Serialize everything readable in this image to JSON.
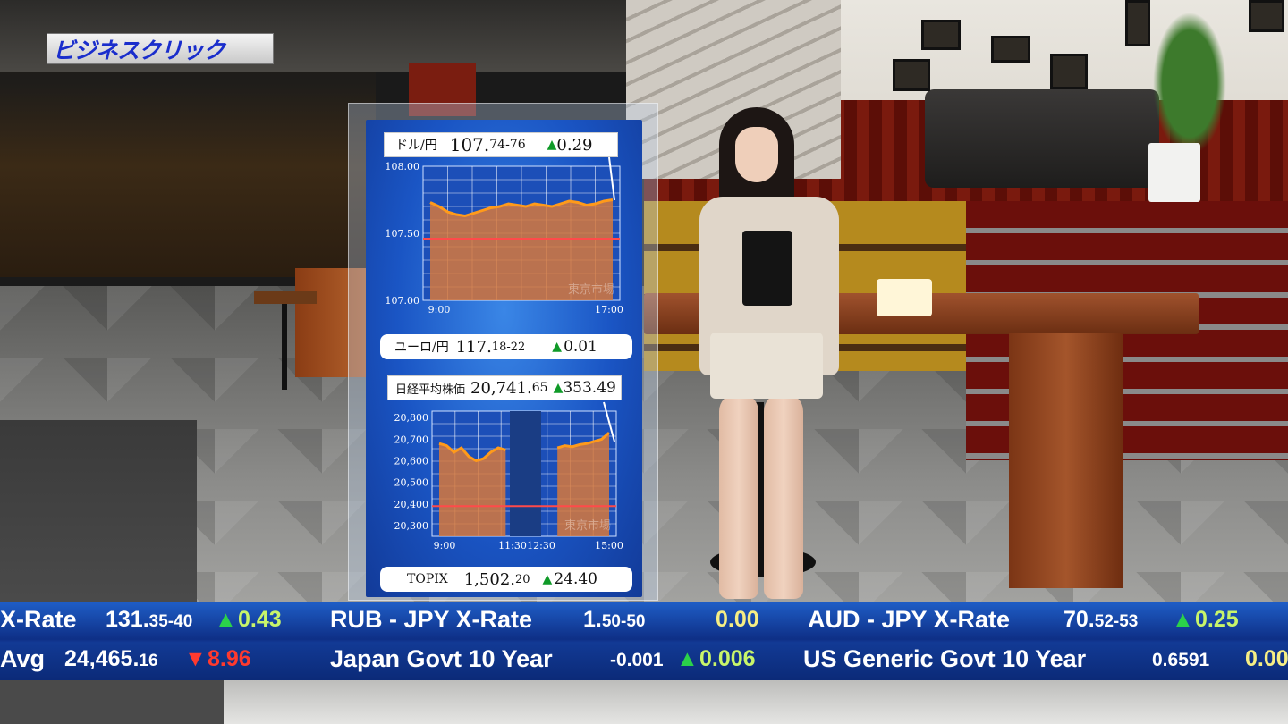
{
  "logo": {
    "text": "ビジネスクリック"
  },
  "panel": {
    "usd_jpy": {
      "name": "ドル/円",
      "main": "107.",
      "sub": "74-76",
      "change": "0.29"
    },
    "eur_jpy": {
      "name": "ユーロ/円",
      "main": "117.",
      "sub": "18-22",
      "change": "0.01"
    },
    "nikkei": {
      "name": "日経平均株価",
      "main": "20,741.",
      "sub": "65",
      "change": "353.49"
    },
    "topix": {
      "name": "TOPIX",
      "main": "1,502.",
      "sub": "20",
      "change": "24.40"
    }
  },
  "chart_data": [
    {
      "type": "line",
      "title": "ドル/円",
      "y_ticks": [
        "108.00",
        "107.50",
        "107.00"
      ],
      "ylim": [
        107.0,
        108.0
      ],
      "x_ticks": [
        "9:00",
        "17:00"
      ],
      "series": [
        {
          "values": [
            107.73,
            107.7,
            107.66,
            107.64,
            107.63,
            107.65,
            107.67,
            107.69,
            107.7,
            107.72,
            107.71,
            107.7,
            107.72,
            107.71,
            107.7,
            107.72,
            107.74,
            107.73,
            107.71,
            107.72,
            107.74,
            107.75
          ]
        }
      ],
      "reference_line": 107.46,
      "grid": true,
      "watermark": "東京市場"
    },
    {
      "type": "line",
      "title": "日経平均株価",
      "y_ticks": [
        "20,800",
        "20,700",
        "20,600",
        "20,500",
        "20,400",
        "20,300"
      ],
      "ylim": [
        20250,
        20830
      ],
      "x_ticks": [
        "9:00",
        "11:30",
        "12:30",
        "15:00"
      ],
      "series": [
        {
          "values": [
            20680,
            20670,
            20640,
            20660,
            20620,
            20600,
            20610,
            20640,
            20660,
            20650,
            null,
            null,
            null,
            null,
            null,
            null,
            20660,
            20670,
            20665,
            20675,
            20680,
            20690,
            20700,
            20730
          ]
        }
      ],
      "reference_line": 20390,
      "lunch_break": [
        "11:30",
        "12:30"
      ],
      "grid": true,
      "watermark": "東京市場"
    }
  ],
  "ticker": {
    "row1": [
      {
        "label": "X-Rate",
        "main": "131.",
        "sub": "35-40",
        "dir": "up",
        "change": "0.43"
      },
      {
        "label": "RUB - JPY X-Rate",
        "main": "1.",
        "sub": "50-50",
        "dir": "none",
        "change": "0.00"
      },
      {
        "label": "AUD - JPY X-Rate",
        "main": "70.",
        "sub": "52-53",
        "dir": "up",
        "change": "0.25"
      }
    ],
    "row2": [
      {
        "label": "Avg",
        "main": "24,465.",
        "sub": "16",
        "dir": "down",
        "change": "8.96"
      },
      {
        "label": "Japan Govt 10 Year",
        "main": "-0.001",
        "sub": "",
        "dir": "up",
        "change": "0.006"
      },
      {
        "label": "US Generic Govt 10 Year",
        "main": "0.6591",
        "sub": "",
        "dir": "none",
        "change": "0.00"
      }
    ]
  }
}
